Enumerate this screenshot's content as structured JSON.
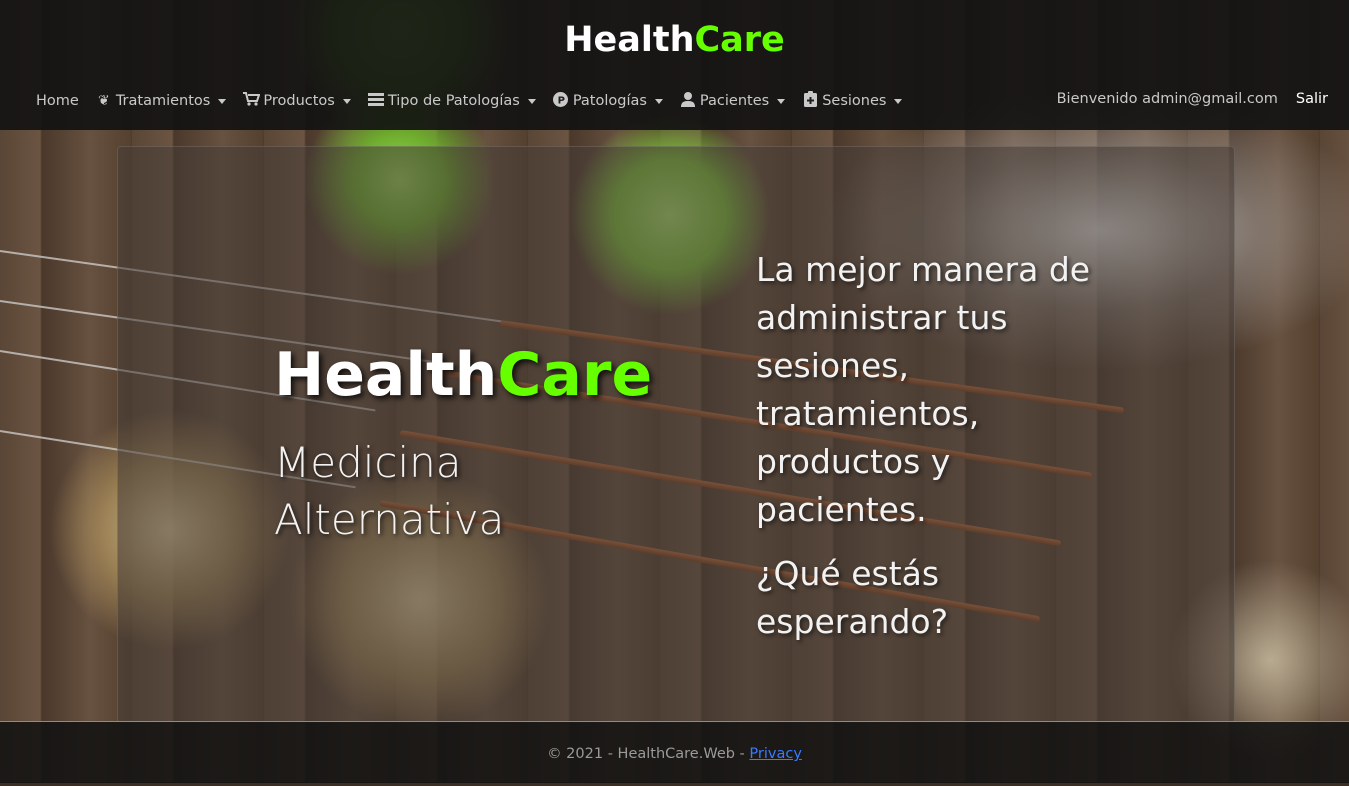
{
  "brand": {
    "part1": "Health",
    "part2": "Care",
    "accent_color": "#66ff00"
  },
  "nav": {
    "home": "Home",
    "items": [
      {
        "label": "Tratamientos",
        "icon": "leaf-hands-icon"
      },
      {
        "label": "Productos",
        "icon": "cart-icon"
      },
      {
        "label": "Tipo de Patologías",
        "icon": "list-icon"
      },
      {
        "label": "Patologías",
        "icon": "p-circle-icon"
      },
      {
        "label": "Pacientes",
        "icon": "user-icon"
      },
      {
        "label": "Sesiones",
        "icon": "clipboard-plus-icon"
      }
    ],
    "welcome": "Bienvenido admin@gmail.com",
    "logout": "Salir"
  },
  "hero": {
    "brand_part1": "Health",
    "brand_part2": "Care",
    "subtitle": "Medicina Alternativa",
    "text": "La mejor manera de administrar tus sesiones, tratamientos, productos y pacientes.",
    "cta": "¿Qué estás esperando?"
  },
  "footer": {
    "text": "© 2021 - HealthCare.Web - ",
    "privacy": "Privacy"
  }
}
